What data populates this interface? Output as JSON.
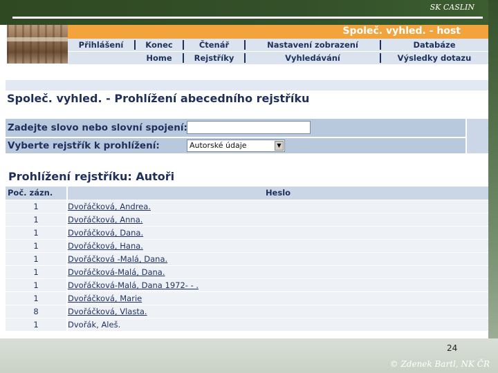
{
  "slide": {
    "brand": "SK CASLIN",
    "page_number": "24",
    "copyright": "© Zdenek Bartl, NK ČR"
  },
  "banner": {
    "title": "Společ. vyhled. - host"
  },
  "nav": {
    "row1": [
      "Přihlášení",
      "Konec",
      "Čtenář",
      "Nastavení zobrazení",
      "Databáze"
    ],
    "row2": [
      "Home",
      "Rejstříky",
      "Vyhledávání",
      "Výsledky dotazu"
    ]
  },
  "page_title": "Společ. vyhled. - Prohlížení abecedního rejstříku",
  "form": {
    "word_label": "Zadejte slovo nebo slovní spojení:",
    "word_value": "",
    "index_label": "Vyberte rejstřík k prohlížení:",
    "index_selected": "Autorské údaje"
  },
  "results": {
    "title": "Prohlížení rejstříku: Autoři",
    "columns": {
      "count": "Poč. zázn.",
      "heading": "Heslo"
    },
    "rows": [
      {
        "count": "1",
        "heading": "Dvořáčková, Andrea."
      },
      {
        "count": "1",
        "heading": "Dvořáčková, Anna."
      },
      {
        "count": "1",
        "heading": "Dvořáčková, Dana."
      },
      {
        "count": "1",
        "heading": "Dvořáčková, Hana."
      },
      {
        "count": "1",
        "heading": "Dvořáčková -Malá, Dana."
      },
      {
        "count": "1",
        "heading": "Dvořáčková-Malá, Dana."
      },
      {
        "count": "1",
        "heading": "Dvořáčková-Malá, Dana 1972- - ."
      },
      {
        "count": "1",
        "heading": "Dvořáčková, Marie"
      },
      {
        "count": "8",
        "heading": "Dvořáčková, Vlasta."
      },
      {
        "count": "1",
        "heading": "Dvořák, Aleš."
      }
    ]
  },
  "colors": {
    "banner": "#f3a33b",
    "nav_bg": "#dbe4ee",
    "text_navy": "#1f2f5c",
    "slide_green": "#34502a"
  }
}
